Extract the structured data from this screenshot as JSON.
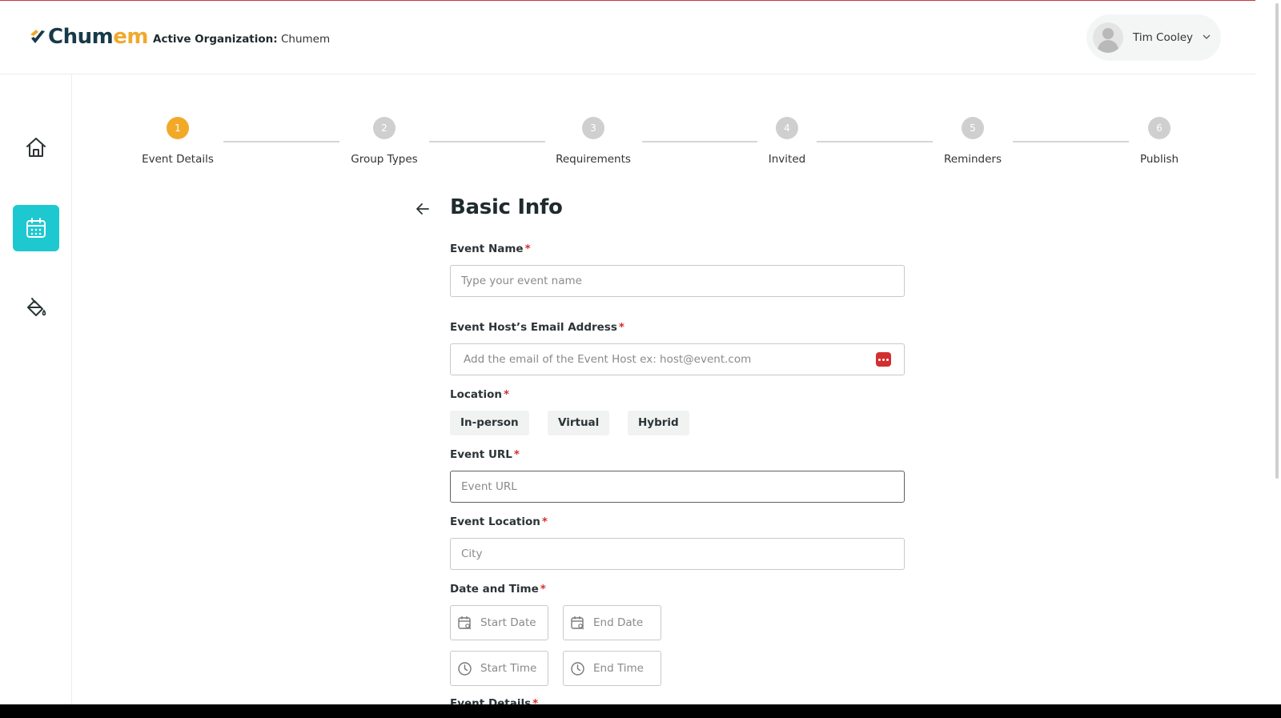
{
  "header": {
    "logo_text_primary": "Chum",
    "logo_text_accent": "em",
    "org_label": "Active Organization:",
    "org_name": "Chumem",
    "user_name": "Tim Cooley"
  },
  "sidebar": {
    "items": [
      {
        "name": "home",
        "icon": "home-icon",
        "active": false
      },
      {
        "name": "events",
        "icon": "calendar-icon",
        "active": true
      },
      {
        "name": "theme",
        "icon": "paint-bucket-icon",
        "active": false
      }
    ]
  },
  "stepper": {
    "current_step": 1,
    "steps": [
      {
        "number": "1",
        "label": "Event Details"
      },
      {
        "number": "2",
        "label": "Group Types"
      },
      {
        "number": "3",
        "label": "Requirements"
      },
      {
        "number": "4",
        "label": "Invited"
      },
      {
        "number": "5",
        "label": "Reminders"
      },
      {
        "number": "6",
        "label": "Publish"
      }
    ]
  },
  "form": {
    "title": "Basic Info",
    "event_name": {
      "label": "Event Name",
      "placeholder": "Type your event name",
      "value": ""
    },
    "host_email": {
      "label": "Event Host’s Email Address",
      "placeholder": "Add the email of the Event Host ex: host@event.com",
      "value": ""
    },
    "location": {
      "label": "Location",
      "options": [
        "In-person",
        "Virtual",
        "Hybrid"
      ]
    },
    "event_url": {
      "label": "Event URL",
      "placeholder": "Event URL",
      "value": ""
    },
    "event_location": {
      "label": "Event Location",
      "placeholder": "City",
      "value": ""
    },
    "date_time": {
      "label": "Date and Time",
      "start_date": "Start Date",
      "end_date": "End Date",
      "start_time": "Start Time",
      "end_time": "End Time"
    },
    "next_section_label": "Event Details"
  },
  "colors": {
    "accent_teal": "#1ec8d0",
    "step_active": "#f2a928",
    "required": "#d32f2f",
    "brand_dark": "#173a4a",
    "brand_orange": "#f0a92c"
  }
}
